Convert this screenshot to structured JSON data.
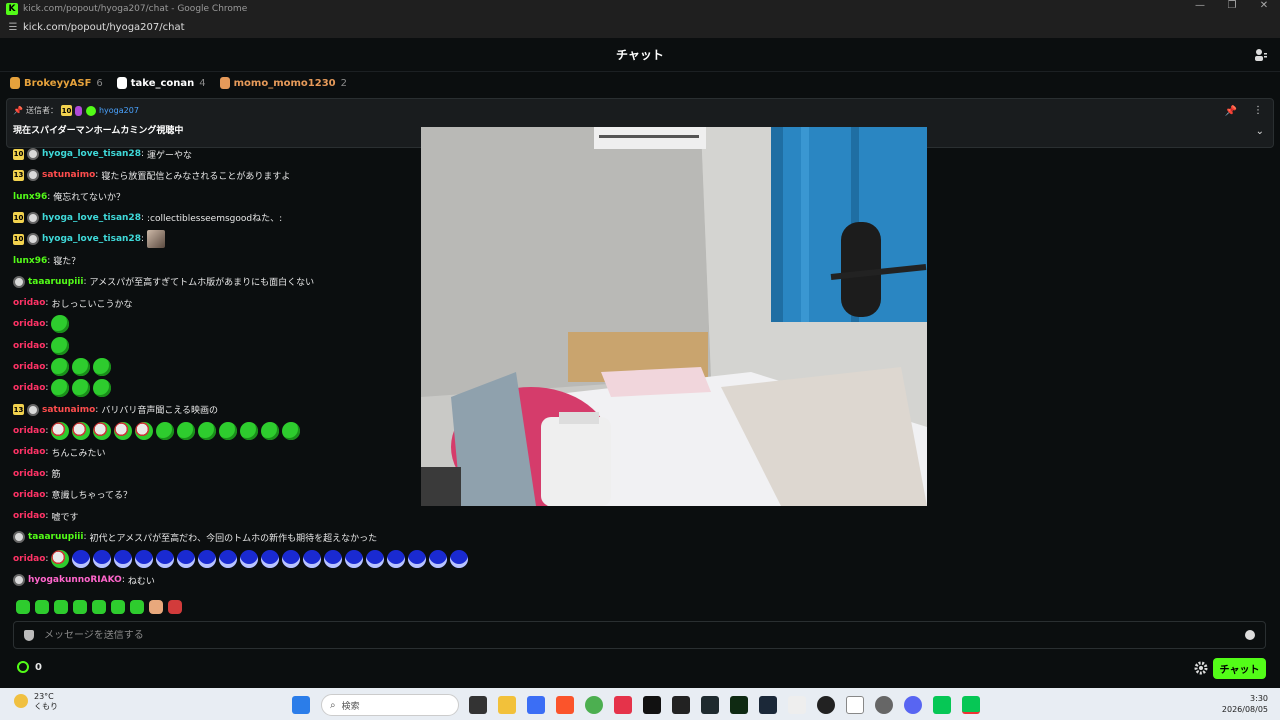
{
  "window": {
    "title": "kick.com/popout/hyoga207/chat - Google Chrome",
    "url": "kick.com/popout/hyoga207/chat"
  },
  "header": {
    "title": "チャット"
  },
  "gifters": [
    {
      "name": "BrokeyyASF",
      "count": "6",
      "color": "#e6a23c"
    },
    {
      "name": "take_conan",
      "count": "4",
      "color": "#ffffff"
    },
    {
      "name": "momo_momo1230",
      "count": "2",
      "color": "#e69a5a"
    }
  ],
  "pinned": {
    "sender_label": "送信者：",
    "badge": "10",
    "user": "hyoga207",
    "text": "現在スパイダーマンホームカミング視聴中"
  },
  "messages": [
    {
      "badge": "10",
      "avatar": true,
      "user": "hyoga_love_tisan28",
      "color": "#3fd9d9",
      "text": "運ゲーやな"
    },
    {
      "badge": "13",
      "avatar": true,
      "user": "satunaimo",
      "color": "#ff4d4d",
      "text": "寝たら放置配信とみなされることがありますよ"
    },
    {
      "badge": "",
      "avatar": false,
      "user": "lunx96",
      "color": "#53fc18",
      "text": "俺忘れてないか？"
    },
    {
      "badge": "10",
      "avatar": true,
      "user": "hyoga_love_tisan28",
      "color": "#3fd9d9",
      "text": ":collectiblesseemsgoodねた、:"
    },
    {
      "badge": "10",
      "avatar": true,
      "user": "hyoga_love_tisan28",
      "color": "#3fd9d9",
      "text": ""
    },
    {
      "badge": "",
      "avatar": false,
      "user": "lunx96",
      "color": "#53fc18",
      "text": "寝た？"
    },
    {
      "badge": "",
      "avatar": true,
      "user": "taaaruupiii",
      "color": "#53fc18",
      "text": "アメスパが至高すぎてトムホ版があまりにも面白くない"
    },
    {
      "badge": "",
      "avatar": false,
      "user": "oridao",
      "color": "#ff3366",
      "text": "おしっこいこうかな"
    },
    {
      "badge": "",
      "avatar": false,
      "user": "oridao",
      "color": "#ff3366",
      "text": ""
    },
    {
      "badge": "",
      "avatar": false,
      "user": "oridao",
      "color": "#ff3366",
      "text": ""
    },
    {
      "badge": "",
      "avatar": false,
      "user": "oridao",
      "color": "#ff3366",
      "text": ""
    },
    {
      "badge": "",
      "avatar": false,
      "user": "oridao",
      "color": "#ff3366",
      "text": ""
    },
    {
      "badge": "13",
      "avatar": true,
      "user": "satunaimo",
      "color": "#ff4d4d",
      "text": "バリバリ音声聞こえる映画の"
    },
    {
      "badge": "",
      "avatar": false,
      "user": "oridao",
      "color": "#ff3366",
      "text": ""
    },
    {
      "badge": "",
      "avatar": false,
      "user": "oridao",
      "color": "#ff3366",
      "text": "ちんこみたい"
    },
    {
      "badge": "",
      "avatar": false,
      "user": "oridao",
      "color": "#ff3366",
      "text": "筋"
    },
    {
      "badge": "",
      "avatar": false,
      "user": "oridao",
      "color": "#ff3366",
      "text": "意識しちゃってる？"
    },
    {
      "badge": "",
      "avatar": false,
      "user": "oridao",
      "color": "#ff3366",
      "text": "嘘です"
    },
    {
      "badge": "",
      "avatar": true,
      "user": "taaaruupiii",
      "color": "#53fc18",
      "text": "初代とアメスパが至高だわ、今回のトムホの新作も期待を超えなかった"
    },
    {
      "badge": "",
      "avatar": false,
      "user": "oridao",
      "color": "#ff3366",
      "text": ""
    },
    {
      "badge": "",
      "avatar": true,
      "user": "hyogakunnoRIAKO",
      "color": "#ff66cc",
      "text": "ねむい"
    }
  ],
  "emotes": {
    "msg4": [
      "img"
    ],
    "msg8": [
      "green"
    ],
    "msg9": [
      "green"
    ],
    "msg10": [
      "green",
      "green",
      "green"
    ],
    "msg11": [
      "green",
      "green",
      "green"
    ],
    "msg13": [
      "ghost",
      "ghost",
      "ghost",
      "ghost",
      "ghost",
      "green",
      "green",
      "green",
      "green",
      "green",
      "green",
      "green"
    ],
    "msg19": [
      "ghost",
      "blue",
      "blue",
      "blue",
      "blue",
      "blue",
      "blue",
      "blue",
      "blue",
      "blue",
      "blue",
      "blue",
      "blue",
      "blue",
      "blue",
      "blue",
      "blue",
      "blue",
      "blue",
      "blue"
    ]
  },
  "input": {
    "placeholder": "メッセージを送信する"
  },
  "footer": {
    "points": "0",
    "send_label": "チャット"
  },
  "taskbar": {
    "temp": "23°C",
    "weather": "くもり",
    "search": "検索",
    "time": "3:30",
    "date": "2026/08/05"
  }
}
